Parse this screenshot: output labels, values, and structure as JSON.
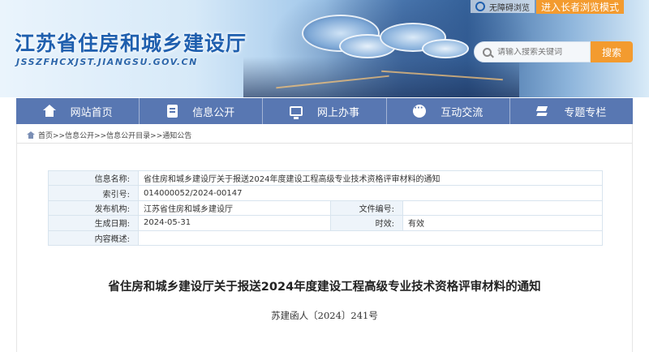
{
  "header": {
    "site_title": "江苏省住房和城乡建设厅",
    "site_domain": "JSSZFHCXJST.JIANGSU.GOV.CN",
    "accessible_label": "无障碍浏览",
    "elder_mode_label": "进入长者浏览模式",
    "search_placeholder": "请输入搜索关键词",
    "search_button": "搜索"
  },
  "nav": {
    "items": [
      {
        "label": "网站首页",
        "icon": "home-icon"
      },
      {
        "label": "信息公开",
        "icon": "document-icon"
      },
      {
        "label": "网上办事",
        "icon": "monitor-icon"
      },
      {
        "label": "互动交流",
        "icon": "chat-icon"
      },
      {
        "label": "专题专栏",
        "icon": "layers-icon"
      }
    ]
  },
  "breadcrumb": {
    "text": "首页>>信息公开>>信息公开目录>>通知公告"
  },
  "info": {
    "name_label": "信息名称:",
    "name_value": "省住房和城乡建设厅关于报送2024年度建设工程高级专业技术资格评审材料的通知",
    "index_label": "索引号:",
    "index_value": "014000052/2024-00147",
    "publisher_label": "发布机构:",
    "publisher_value": "江苏省住房和城乡建设厅",
    "file_no_label": "文件编号:",
    "file_no_value": "",
    "date_label": "生成日期:",
    "date_value": "2024-05-31",
    "validity_label": "时效:",
    "validity_value": "有效",
    "summary_label": "内容概述:",
    "summary_value": ""
  },
  "article": {
    "title": "省住房和城乡建设厅关于报送2024年度建设工程高级专业技术资格评审材料的通知",
    "doc_number": "苏建函人〔2024〕241号"
  },
  "colors": {
    "nav_bg": "#5877b2",
    "accent_orange": "#f39b2f",
    "title_blue": "#1f5fae",
    "label_bg": "#eef4fa"
  }
}
